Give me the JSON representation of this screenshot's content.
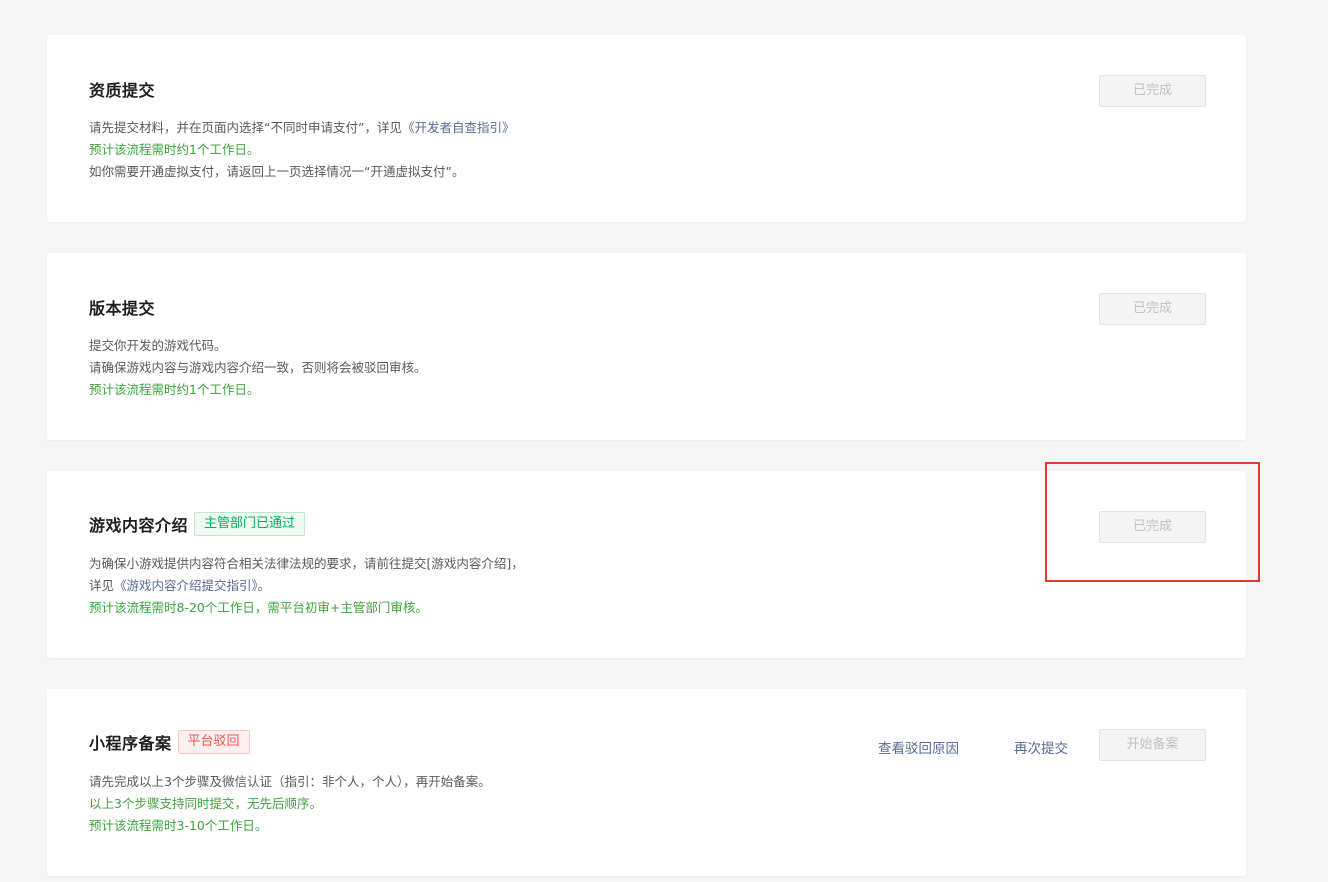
{
  "colors": {
    "background": "#f6f6f6",
    "success": "#06ae56",
    "danger": "#fa5151",
    "link": "#576b95",
    "estimate_text": "#3fa33f",
    "highlight": "#e03b32"
  },
  "sections": [
    {
      "title": "资质提交",
      "tag": "",
      "button": "已完成",
      "desc": {
        "line1_text": "请先提交材料，并在页面内选择“不同时申请支付”，详见",
        "line1_link": "《开发者自查指引》",
        "line2": "预计该流程需时约1个工作日。",
        "line3": "如你需要开通虚拟支付，请返回上一页选择情况一“开通虚拟支付”。"
      }
    },
    {
      "title": "版本提交",
      "tag": "",
      "button": "已完成",
      "desc": {
        "line1": "提交你开发的游戏代码。",
        "line2": "请确保游戏内容与游戏内容介绍一致，否则将会被驳回审核。",
        "line3": "预计该流程需时约1个工作日。"
      }
    },
    {
      "title": "游戏内容介绍",
      "tag": "主管部门已通过",
      "button": "已完成",
      "desc": {
        "line1": "为确保小游戏提供内容符合相关法律法规的要求，请前往提交[游戏内容介绍]，",
        "line2_prefix": "详见",
        "line2_link": "《游戏内容介绍提交指引》",
        "line2_suffix": "。",
        "line3": "预计该流程需时8-20个工作日，需平台初审+主管部门审核。"
      }
    },
    {
      "title": "小程序备案",
      "tag": "平台驳回",
      "button": "开始备案",
      "actions": [
        "查看驳回原因",
        "再次提交"
      ],
      "desc": {
        "line1": "请先完成以上3个步骤及微信认证（指引：非个人，个人），再开始备案。",
        "line2": "以上3个步骤支持同时提交，无先后顺序。",
        "line3": "预计该流程需时3-10个工作日。"
      }
    }
  ]
}
